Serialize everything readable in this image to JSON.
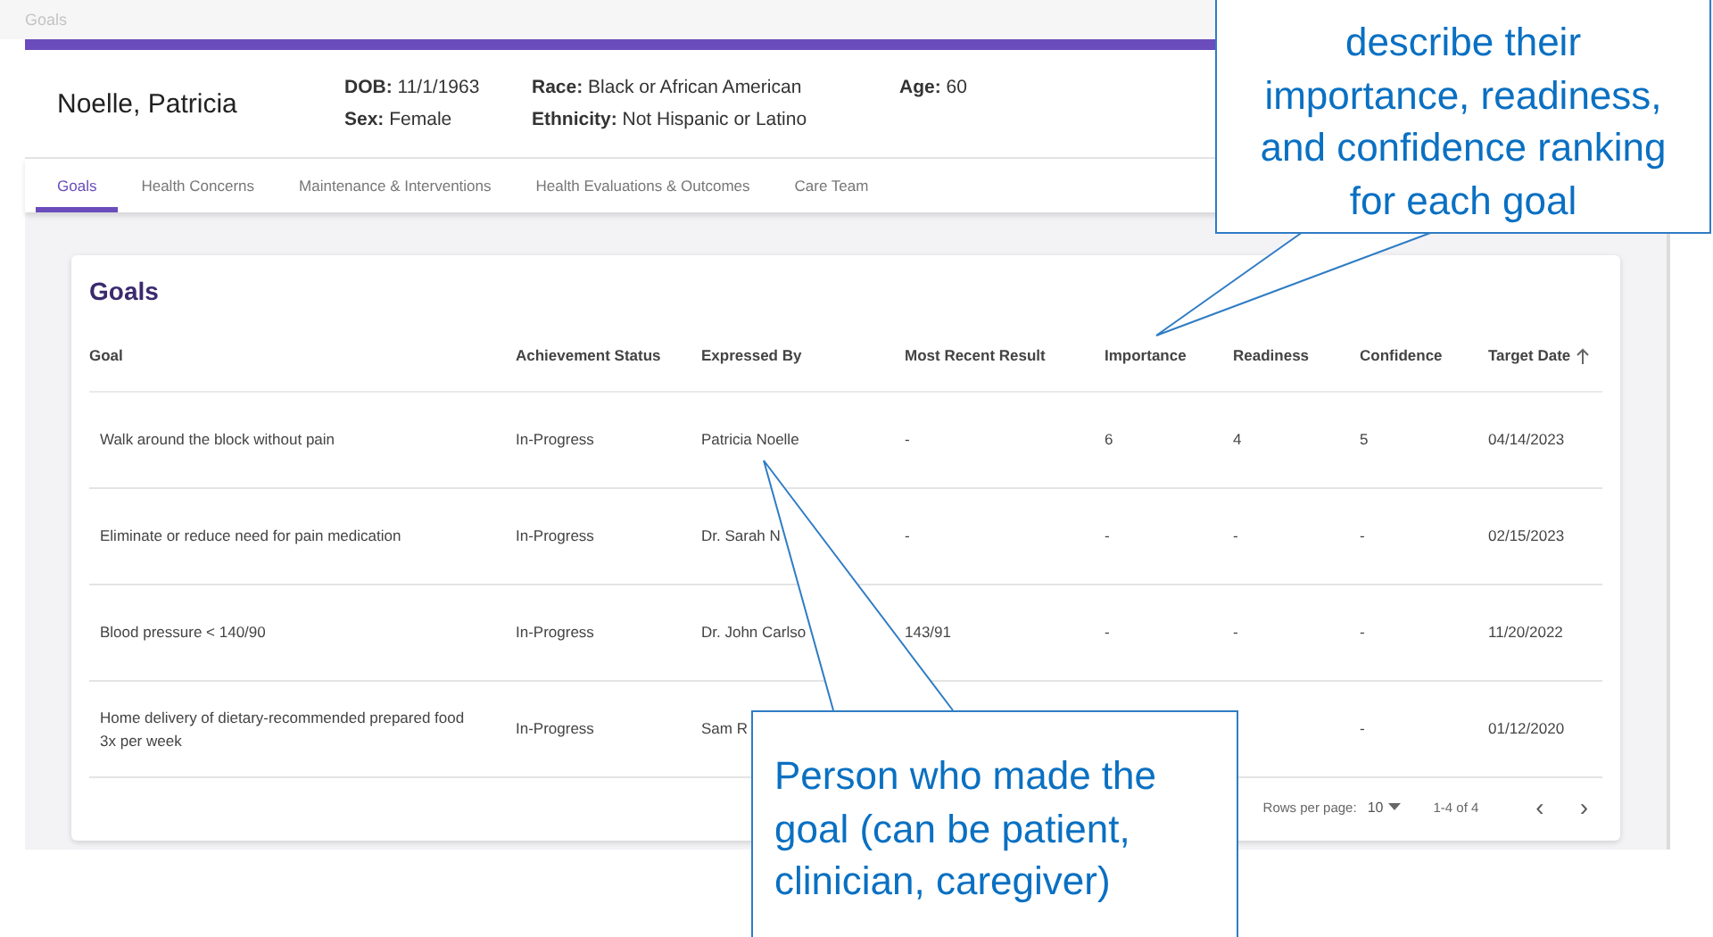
{
  "page_title": "Goals",
  "patient": {
    "name": "Noelle, Patricia",
    "fields": [
      {
        "text": "**DOB:** 11/1/1963"
      },
      {
        "text": "**Sex:** Female"
      },
      {
        "text": "**Race:** Black or African American"
      },
      {
        "text": "**Ethnicity:** Not Hispanic or Latino"
      },
      {
        "text": "**Age:** 60"
      }
    ]
  },
  "tabs": [
    {
      "label": "Goals",
      "selected": true
    },
    {
      "label": "Health Concerns",
      "selected": false
    },
    {
      "label": "Maintenance & Interventions",
      "selected": false
    },
    {
      "label": "Health Evaluations & Outcomes",
      "selected": false
    },
    {
      "label": "Care Team",
      "selected": false
    }
  ],
  "goals_card": {
    "title": "Goals",
    "table": {
      "columns": [
        {
          "label": "Goal",
          "sort_ascending": false
        },
        {
          "label": "Achievement Status",
          "sort_ascending": false
        },
        {
          "label": "Expressed By",
          "sort_ascending": false
        },
        {
          "label": "Most Recent Result",
          "sort_ascending": false
        },
        {
          "label": "Importance",
          "sort_ascending": false
        },
        {
          "label": "Readiness",
          "sort_ascending": false
        },
        {
          "label": "Confidence",
          "sort_ascending": false
        },
        {
          "label": "Target Date",
          "sort_ascending": true
        }
      ],
      "rows": [
        {
          "cells": [
            "Walk around the block without pain",
            "In-Progress",
            "Patricia Noelle",
            "-",
            "6",
            "4",
            "5",
            "04/14/2023"
          ]
        },
        {
          "cells": [
            "Eliminate or reduce need for pain medication",
            "In-Progress",
            "Dr. Sarah N",
            "-",
            "-",
            "-",
            "-",
            "02/15/2023"
          ]
        },
        {
          "cells": [
            "Blood pressure < 140/90",
            "In-Progress",
            "Dr. John Carlso",
            "143/91",
            "-",
            "-",
            "-",
            "11/20/2022"
          ]
        },
        {
          "cells": [
            "Home delivery of dietary-recommended prepared food 3x per week",
            "In-Progress",
            "Sam R"
          ],
          "cells_after_callout": [
            "-",
            "01/12/2020"
          ]
        }
      ]
    },
    "pagination": {
      "rows_per_page_label": "Rows per page:",
      "rows_per_page": "10",
      "range": "1-4 of 4",
      "prev": "‹",
      "next": "›"
    }
  },
  "callouts": [
    {
      "kind": "top",
      "text": "describe their\nimportance, readiness,\nand confidence ranking\nfor each goal"
    },
    {
      "kind": "bottom",
      "text": "Person who made the\ngoal (can be patient,\nclinician, caregiver)"
    }
  ]
}
